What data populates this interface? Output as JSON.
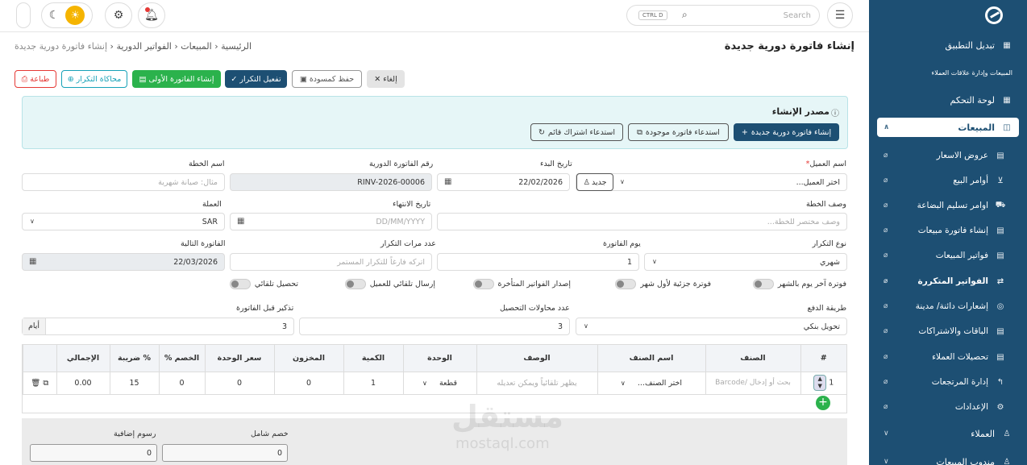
{
  "topbar": {
    "search_placeholder": "Search",
    "kbd": "CTRL D"
  },
  "breadcrumb": {
    "home": "الرئيسية",
    "sales": "المبيعات",
    "recurring": "الفواتير الدورية",
    "current": "إنشاء فاتورة دورية جديدة"
  },
  "page_title": "إنشاء فاتورة دورية جديدة",
  "actions": {
    "cancel": "إلغاء",
    "draft": "حفظ كمسودة",
    "enable": "تفعيل التكرار",
    "create_first": "إنشاء الفاتورة الأولى",
    "simulate": "محاكاة التكرار",
    "print": "طباعة"
  },
  "source": {
    "title": "مصدر الإنشاء",
    "new": "إنشاء فاتورة دورية جديدة",
    "existing_invoice": "استدعاء فاتورة موجودة",
    "existing_sub": "استدعاء اشتراك قائم"
  },
  "form": {
    "customer_label": "اسم العميل",
    "customer_required": "*",
    "customer_value": "اختر العميل...",
    "new_label": "جديد",
    "start_label": "تاريخ البدء",
    "start_value": "22/02/2026",
    "number_label": "رقم الفاتورة الدورية",
    "number_value": "RINV-2026-00006",
    "plan_label": "اسم الخطة",
    "plan_placeholder": "مثال: صيانة شهرية",
    "desc_label": "وصف الخطة",
    "desc_placeholder": "وصف مختصر للخطة...",
    "end_label": "تاريخ الانتهاء",
    "end_placeholder": "DD/MM/YYYY",
    "currency_label": "العملة",
    "currency_value": "SAR",
    "repeat_label": "نوع التكرار",
    "repeat_value": "شهري",
    "day_label": "يوم الفاتورة",
    "day_value": "1",
    "count_label": "عدد مرات التكرار",
    "count_placeholder": "اتركه فارغاً للتكرار المستمر",
    "next_label": "الفاتورة التالية",
    "next_value": "22/03/2026",
    "t1": "فوترة آخر يوم بالشهر",
    "t2": "فوترة جزئية لأول شهر",
    "t3": "إصدار الفواتير المتأخرة",
    "t4": "إرسال تلقائي للعميل",
    "t5": "تحصيل تلقائي",
    "pay_label": "طريقة الدفع",
    "pay_value": "تحويل بنكي",
    "attempts_label": "عدد محاولات التحصيل",
    "attempts_value": "3",
    "remind_label": "تذكير قبل الفاتورة",
    "remind_value": "3",
    "remind_unit": "أيام"
  },
  "table": {
    "headers": [
      "#",
      "الصنف",
      "اسم الصنف",
      "الوصف",
      "الوحدة",
      "الكمية",
      "المخزون",
      "سعر الوحدة",
      "الخصم %",
      "% ضريبة",
      "الإجمالي",
      ""
    ],
    "row": {
      "num": "1",
      "item_placeholder": "بحث أو إدخال /Barcode",
      "name": "اختر الصنف...",
      "desc_placeholder": "يظهر تلقائياً ويمكن تعديله",
      "unit": "قطعة",
      "qty": "1",
      "stock": "0",
      "price": "0",
      "discount": "0",
      "tax": "15",
      "total": "0.00"
    }
  },
  "summary": {
    "discount_label": "خصم شامل",
    "discount_value": "0",
    "fees_label": "رسوم إضافية",
    "fees_value": "0"
  },
  "watermark": {
    "ar": "مستقل",
    "en": "mostaql.com"
  },
  "sidebar": {
    "switch_app": "تبديل التطبيق",
    "group": "المبيعات وإدارة علاقات العملاء",
    "dashboard": "لوحة التحكم",
    "sales": "المبيعات",
    "items": [
      "عروض الاسعار",
      "أوامر البيع",
      "اوامر تسليم البضاعة",
      "إنشاء فاتورة مبيعات",
      "فواتير المبيعات",
      "الفواتير المتكررة",
      "إشعارات دائنة/ مدينة",
      "الباقات والاشتراكات",
      "تحصيلات العملاء",
      "إدارة المرتجعات",
      "الإعدادات"
    ],
    "customers": "العملاء",
    "reps": "مندوب المبيعات"
  }
}
